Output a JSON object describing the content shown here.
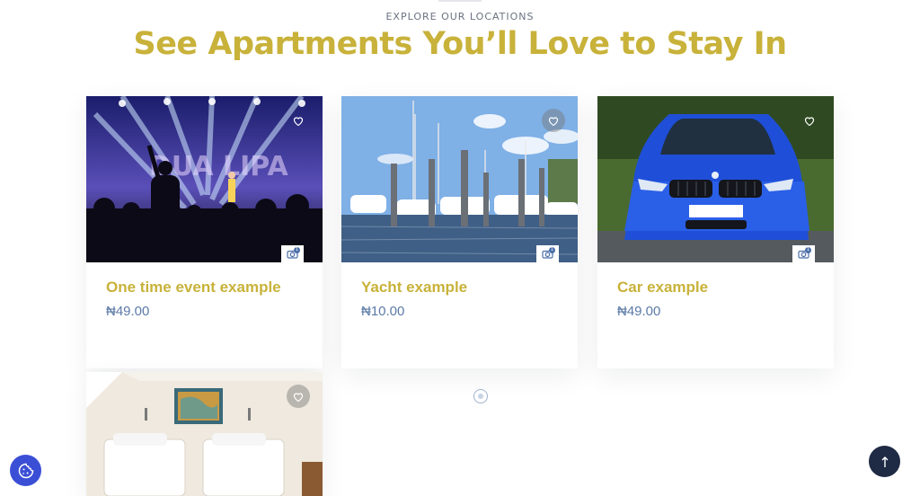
{
  "section": {
    "eyebrow": "EXPLORE OUR LOCATIONS",
    "title": "See Apartments You’ll Love to Stay In"
  },
  "listings": [
    {
      "name": "One time event example",
      "price": "₦49.00",
      "photo_count": "1",
      "image": "concert-photo"
    },
    {
      "name": "Yacht example",
      "price": "₦10.00",
      "photo_count": "1",
      "image": "marina-photo"
    },
    {
      "name": "Car example",
      "price": "₦49.00",
      "photo_count": "1",
      "image": "blue-car-photo"
    },
    {
      "name": "",
      "price": "",
      "photo_count": "",
      "image": "bedroom-photo"
    }
  ],
  "colors": {
    "accent": "#c8b23a",
    "price": "#5b7aa6",
    "cookie_button": "#3b4fd6",
    "scroll_top_button": "#1f2a44"
  },
  "icons": {
    "favorite": "heart-icon",
    "gallery": "camera-icon",
    "cookie": "cookie-icon",
    "scroll_top": "arrow-up-icon",
    "loading": "loading-spinner-icon"
  }
}
